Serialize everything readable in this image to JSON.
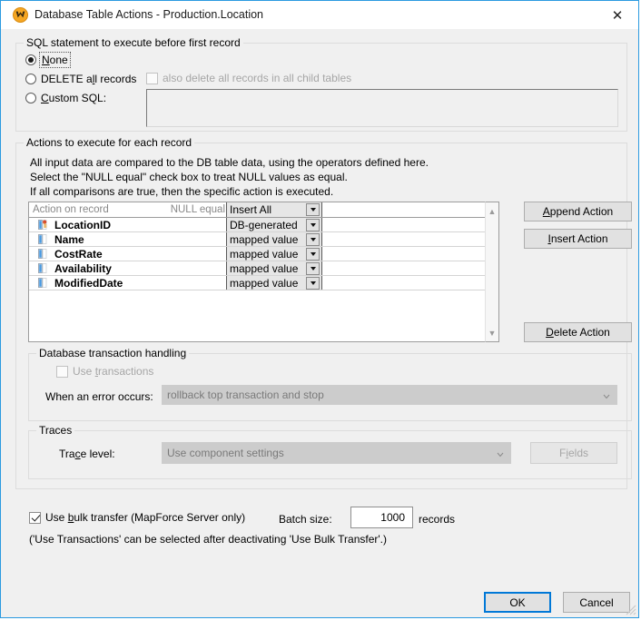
{
  "window": {
    "title": "Database Table Actions - Production.Location",
    "icon": "mapforce-icon",
    "close_label": "✕"
  },
  "sql_group": {
    "title": "SQL statement to execute before first record",
    "options": [
      {
        "label": "None",
        "accel": "N",
        "checked": true
      },
      {
        "label": "DELETE all records",
        "accel": "l",
        "checked": false
      },
      {
        "label": "Custom SQL:",
        "accel": "C",
        "checked": false
      }
    ],
    "child_checkbox": {
      "label": "also delete all records in all child tables",
      "checked": false,
      "disabled": true
    },
    "custom_sql_value": "",
    "custom_sql_disabled": true
  },
  "actions_group": {
    "title": "Actions to execute for each record",
    "description_lines": [
      "All input data are compared to the DB table data, using the operators defined here.",
      "Select the \"NULL equal\" check box to treat NULL values as equal.",
      "If all comparisons are true, then the specific action is executed."
    ],
    "grid": {
      "headers": {
        "action_on_record": "Action on record",
        "null_equal": "NULL equal",
        "action_select": "Insert All"
      },
      "rows": [
        {
          "name": "LocationID",
          "icon": "primary-key-column-icon",
          "action": "DB-generated"
        },
        {
          "name": "Name",
          "icon": "column-icon",
          "action": "mapped value"
        },
        {
          "name": "CostRate",
          "icon": "column-icon",
          "action": "mapped value"
        },
        {
          "name": "Availability",
          "icon": "column-icon",
          "action": "mapped value"
        },
        {
          "name": "ModifiedDate",
          "icon": "column-icon",
          "action": "mapped value"
        }
      ]
    },
    "buttons": {
      "append": "Append Action",
      "insert": "Insert Action",
      "delete": "Delete Action"
    }
  },
  "transaction_group": {
    "title": "Database transaction handling",
    "use_transactions": {
      "label": "Use transactions",
      "checked": false,
      "disabled": true
    },
    "error_label": "When an error occurs:",
    "error_value": "rollback top transaction and stop"
  },
  "traces_group": {
    "title": "Traces",
    "trace_level_label": "Trace level:",
    "trace_level_value": "Use component settings",
    "fields_button": "Fields"
  },
  "bulk": {
    "checkbox_label": "Use bulk transfer (MapForce Server only)",
    "checkbox_checked": true,
    "batch_size_label": "Batch size:",
    "batch_size_value": "1000",
    "records_label": "records",
    "note": "('Use Transactions' can be selected after deactivating 'Use Bulk Transfer'.)"
  },
  "footer": {
    "ok": "OK",
    "cancel": "Cancel"
  },
  "colors": {
    "accent": "#0078d7",
    "dialog_border": "#2b9ae0",
    "dialog_bg": "#f0f0f0",
    "disabled_text": "#a6a6a6"
  }
}
